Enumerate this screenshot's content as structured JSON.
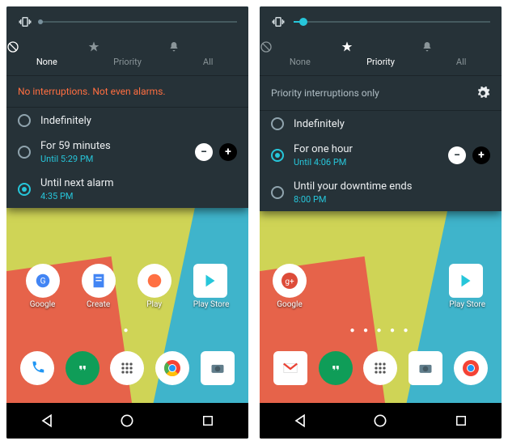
{
  "left": {
    "volume_level": 0,
    "tabs": {
      "none": "None",
      "priority": "Priority",
      "all": "All",
      "active": "none"
    },
    "message": "No interruptions. Not even alarms.",
    "options": [
      {
        "label": "Indefinitely",
        "sub": "",
        "selected": false,
        "stepper": false
      },
      {
        "label": "For 59 minutes",
        "sub": "Until 5:29 PM",
        "selected": false,
        "stepper": true
      },
      {
        "label": "Until next alarm",
        "sub": "4:35 PM",
        "selected": true,
        "stepper": false
      }
    ],
    "apps_top": [
      {
        "l": "Google"
      },
      {
        "l": "Create"
      },
      {
        "l": "Play"
      },
      {
        "l": "Play Store"
      }
    ],
    "page_dots": "●"
  },
  "right": {
    "volume_level": 5,
    "tabs": {
      "none": "None",
      "priority": "Priority",
      "all": "All",
      "active": "priority"
    },
    "message": "Priority interruptions only",
    "options": [
      {
        "label": "Indefinitely",
        "sub": "",
        "selected": false,
        "stepper": false
      },
      {
        "label": "For one hour",
        "sub": "Until 4:06 PM",
        "selected": true,
        "stepper": true
      },
      {
        "label": "Until your downtime ends",
        "sub": "8:00 PM",
        "selected": false,
        "stepper": false
      }
    ],
    "apps_top": [
      {
        "l": "Google"
      },
      {
        "l": "Play Store"
      }
    ],
    "page_dots": "● ● ● ● ●"
  }
}
